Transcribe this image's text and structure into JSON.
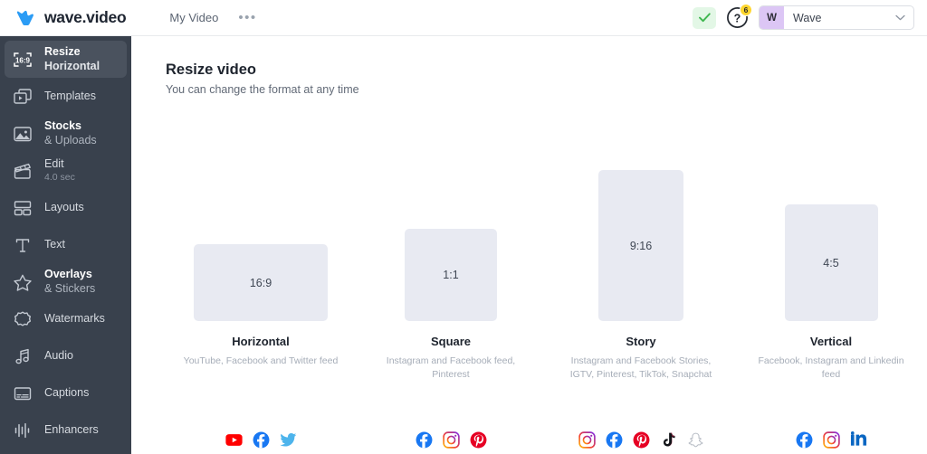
{
  "topbar": {
    "brand_name": "wave.video",
    "brand_icon": "wave-logo-icon",
    "nav": [
      {
        "label": "My Video",
        "icon": ""
      },
      {
        "label": "•••",
        "icon": "more-dots-icon"
      }
    ],
    "status_check_icon": "green-check-icon",
    "help_icon": "question-mark-circle-icon",
    "help_badge_count": "6",
    "user": {
      "avatar_initial": "W",
      "name": "Wave",
      "chevron_icon": "chevron-down-icon"
    }
  },
  "sidebar": {
    "items": [
      {
        "label": "Resize",
        "sub": "Horizontal",
        "icon": "resize-crop-169-icon",
        "active": true,
        "sub_small": false
      },
      {
        "label": "Templates",
        "sub": "",
        "icon": "templates-stack-icon",
        "active": false,
        "sub_small": false
      },
      {
        "label": "Stocks",
        "sub": "& Uploads",
        "icon": "image-mountain-icon",
        "active": false,
        "sub_small": false
      },
      {
        "label": "Edit",
        "sub": "4.0 sec",
        "icon": "clapperboard-icon",
        "active": false,
        "sub_small": true
      },
      {
        "label": "Layouts",
        "sub": "",
        "icon": "layouts-grid-icon",
        "active": false,
        "sub_small": false
      },
      {
        "label": "Text",
        "sub": "",
        "icon": "text-t-icon",
        "active": false,
        "sub_small": false
      },
      {
        "label": "Overlays",
        "sub": "& Stickers",
        "icon": "star-icon",
        "active": false,
        "sub_small": false
      },
      {
        "label": "Watermarks",
        "sub": "",
        "icon": "badge-seal-icon",
        "active": false,
        "sub_small": false
      },
      {
        "label": "Audio",
        "sub": "",
        "icon": "music-note-icon",
        "active": false,
        "sub_small": false
      },
      {
        "label": "Captions",
        "sub": "",
        "icon": "captions-box-icon",
        "active": false,
        "sub_small": false
      },
      {
        "label": "Enhancers",
        "sub": "",
        "icon": "waveform-icon",
        "active": false,
        "sub_small": false
      }
    ]
  },
  "main": {
    "title": "Resize video",
    "subtitle": "You can change the format at any time",
    "cards": [
      {
        "ratio": "16:9",
        "name": "Horizontal",
        "desc": "YouTube, Facebook and Twitter feed",
        "preview_w": 148,
        "preview_h": 85,
        "socials": [
          "youtube-icon",
          "facebook-icon",
          "twitter-icon"
        ]
      },
      {
        "ratio": "1:1",
        "name": "Square",
        "desc": "Instagram and Facebook feed, Pinterest",
        "preview_w": 102,
        "preview_h": 102,
        "socials": [
          "facebook-icon",
          "instagram-icon",
          "pinterest-icon"
        ]
      },
      {
        "ratio": "9:16",
        "name": "Story",
        "desc": "Instagram and Facebook Stories, IGTV, Pinterest, TikTok, Snapchat",
        "preview_w": 94,
        "preview_h": 167,
        "socials": [
          "instagram-icon",
          "facebook-icon",
          "pinterest-icon",
          "tiktok-icon",
          "snapchat-icon"
        ]
      },
      {
        "ratio": "4:5",
        "name": "Vertical",
        "desc": "Facebook, Instagram and Linkedin feed",
        "preview_w": 103,
        "preview_h": 129,
        "socials": [
          "facebook-icon",
          "instagram-icon",
          "linkedin-icon"
        ]
      }
    ]
  },
  "colors": {
    "sidebar_bg": "#39414d",
    "sidebar_active": "#4a525e",
    "preview_fill": "#e8eaf2",
    "brand_blue": "#2b9cf5",
    "badge_yellow": "#ffd62e",
    "check_green": "#3fb750",
    "avatar_purple": "#dcc6f5",
    "youtube_red": "#ff0000",
    "facebook_blue": "#1877f2",
    "twitter_blue": "#4db4ec",
    "pinterest_red": "#e60023",
    "linkedin_blue": "#0a66c2",
    "snapchat_outline": "#b9bec6"
  }
}
